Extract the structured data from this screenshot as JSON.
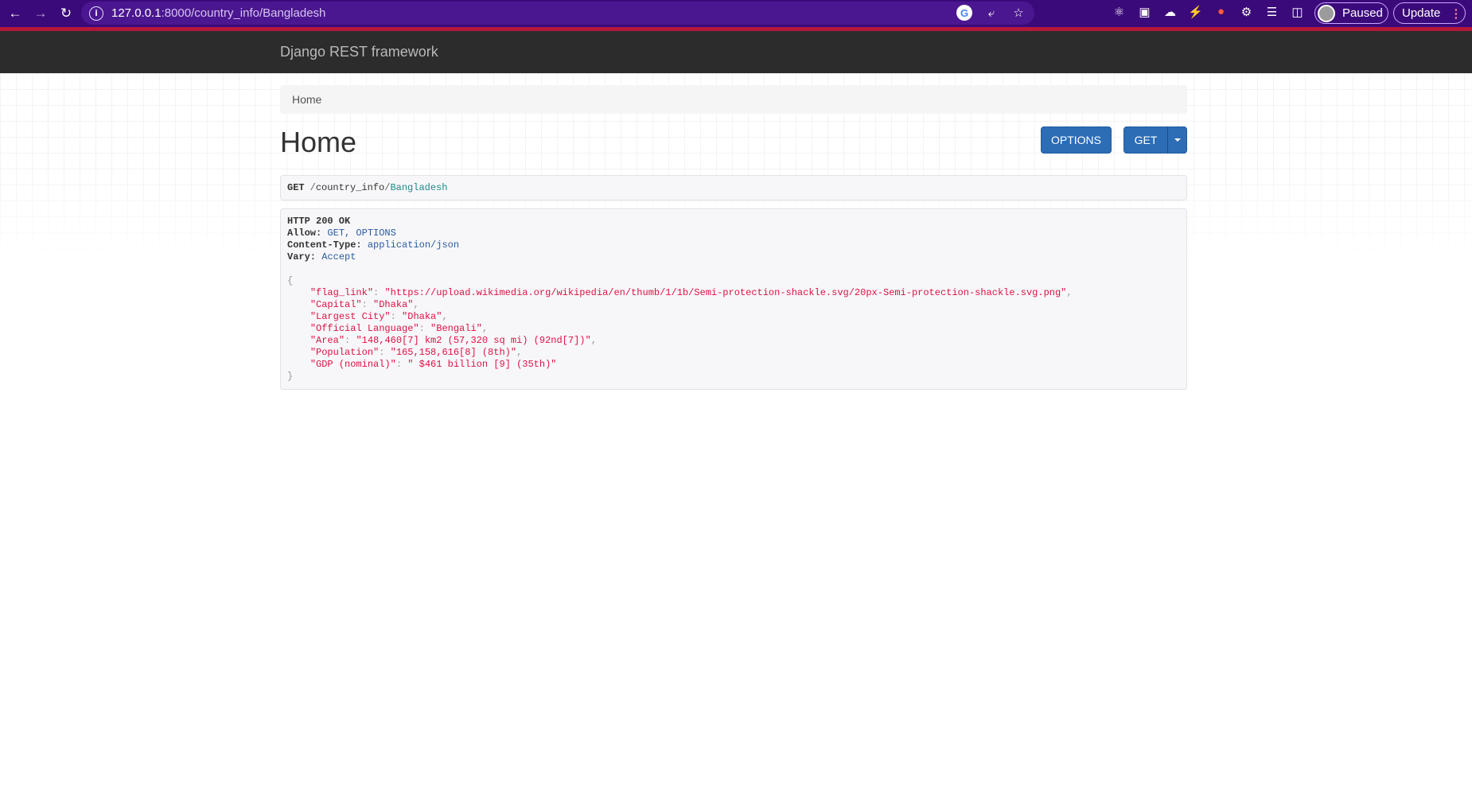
{
  "browser": {
    "url_host": "127.0.0.1",
    "url_rest": ":8000/country_info/Bangladesh",
    "profile_status": "Paused",
    "update_label": "Update"
  },
  "navbar": {
    "brand": "Django REST framework"
  },
  "breadcrumb": {
    "home": "Home"
  },
  "page": {
    "title": "Home",
    "options_button": "OPTIONS",
    "get_button": "GET"
  },
  "request": {
    "method": "GET",
    "path_part": "country_info",
    "path_literal": "Bangladesh"
  },
  "response": {
    "status": "HTTP 200 OK",
    "headers": [
      {
        "key": "Allow:",
        "value": "GET, OPTIONS"
      },
      {
        "key": "Content-Type:",
        "value": "application/json"
      },
      {
        "key": "Vary:",
        "value": "Accept"
      }
    ],
    "body": [
      {
        "key": "\"flag_link\"",
        "value": "\"https://upload.wikimedia.org/wikipedia/en/thumb/1/1b/Semi-protection-shackle.svg/20px-Semi-protection-shackle.svg.png\"",
        "comma": ","
      },
      {
        "key": "\"Capital\"",
        "value": "\"Dhaka\"",
        "comma": ","
      },
      {
        "key": "\"Largest City\"",
        "value": "\"Dhaka\"",
        "comma": ","
      },
      {
        "key": "\"Official Language\"",
        "value": "\"Bengali\"",
        "comma": ","
      },
      {
        "key": "\"Area\"",
        "value": "\"148,460[7] km2 (57,320 sq mi) (92nd[7])\"",
        "comma": ","
      },
      {
        "key": "\"Population\"",
        "value": "\"165,158,616[8] (8th)\"",
        "comma": ","
      },
      {
        "key": "\"GDP (nominal)\"",
        "value": "\" $461 billion [9] (35th)\"",
        "comma": ""
      }
    ]
  }
}
